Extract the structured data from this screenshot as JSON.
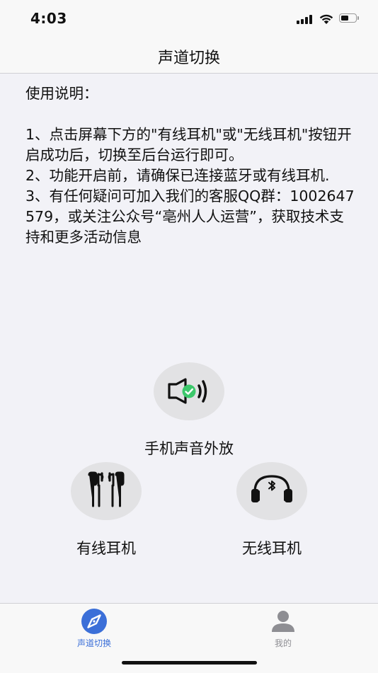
{
  "status_bar": {
    "time": "4:03"
  },
  "nav": {
    "title": "声道切换"
  },
  "instructions": {
    "heading": "使用说明：",
    "items": [
      "1、点击屏幕下方的\"有线耳机\"或\"无线耳机\"按钮开启成功后，切换至后台运行即可。",
      "2、功能开启前，请确保已连接蓝牙或有线耳机.",
      "3、有任何疑问可加入我们的客服QQ群：1002647579，或关注公众号“亳州人人运营”，获取技术支持和更多活动信息"
    ]
  },
  "modes": {
    "speaker": {
      "label": "手机声音外放",
      "icon": "speaker-active-icon",
      "active": true
    },
    "wired": {
      "label": "有线耳机",
      "icon": "wired-earphones-icon"
    },
    "wireless": {
      "label": "无线耳机",
      "icon": "bluetooth-headphones-icon"
    }
  },
  "tabs": [
    {
      "label": "声道切换",
      "icon": "compass-icon",
      "active": true
    },
    {
      "label": "我的",
      "icon": "user-icon",
      "active": false
    }
  ],
  "colors": {
    "accent": "#3b6fd8",
    "check": "#3cc86b",
    "inactive_tab": "#8e8e93"
  }
}
